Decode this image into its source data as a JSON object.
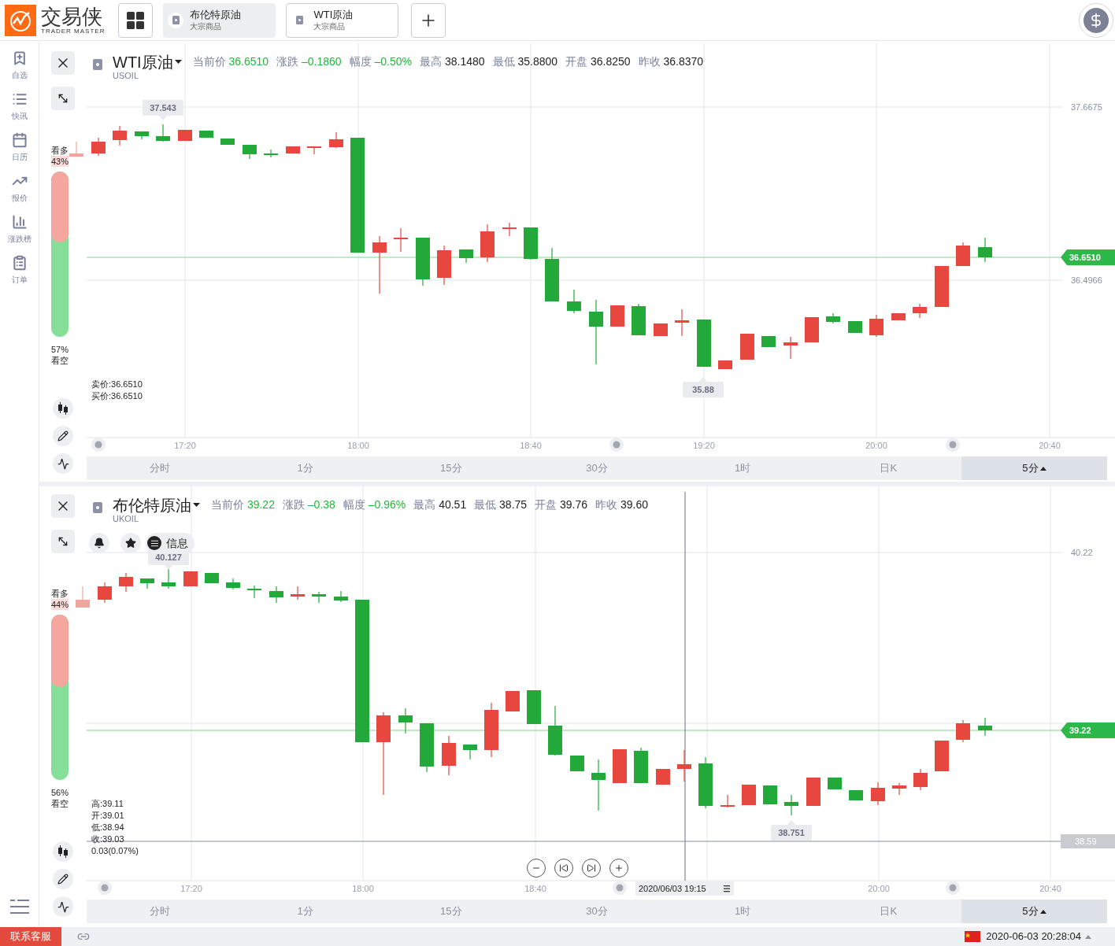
{
  "header": {
    "logo": {
      "name": "交易侠",
      "tagline": "TRADER MASTER"
    },
    "tabs": [
      {
        "title": "布伦特原油",
        "subtitle": "大宗商品",
        "selected": true
      },
      {
        "title": "WTI原油",
        "subtitle": "大宗商品",
        "selected": false
      }
    ]
  },
  "sidebar": {
    "items": [
      {
        "label": "自选"
      },
      {
        "label": "快讯"
      },
      {
        "label": "日历"
      },
      {
        "label": "报价"
      },
      {
        "label": "涨跌榜"
      },
      {
        "label": "订单"
      }
    ]
  },
  "panels": [
    {
      "symbol": "WTI原油",
      "code": "USOIL",
      "stats": [
        {
          "label": "当前价",
          "value": "36.6510",
          "color": "#22b83c"
        },
        {
          "label": "涨跌",
          "value": "–0.1860",
          "color": "#22b83c"
        },
        {
          "label": "幅度",
          "value": "–0.50%",
          "color": "#22b83c"
        },
        {
          "label": "最高",
          "value": "38.1480",
          "color": "#222222"
        },
        {
          "label": "最低",
          "value": "35.8800",
          "color": "#222222"
        },
        {
          "label": "开盘",
          "value": "36.8250",
          "color": "#222222"
        },
        {
          "label": "昨收",
          "value": "36.8370",
          "color": "#222222"
        }
      ],
      "sentiment": {
        "bull_label": "看多",
        "bull_pct": "43%",
        "level": 0.43,
        "bear_pct": "57%",
        "bear_label": "看空"
      },
      "info_lines": [
        "卖价:36.6510",
        "买价:36.6510"
      ],
      "y_ticks": [
        "37.6675",
        "36.4966"
      ],
      "price_tag": "36.6510",
      "markers": [
        "37.543",
        "35.88"
      ],
      "time_labels": [
        "17:20",
        "18:00",
        "18:40",
        "19:20",
        "20:00",
        "20:40"
      ],
      "timeframes": [
        {
          "label": "分时",
          "selected": false
        },
        {
          "label": "1分",
          "selected": false
        },
        {
          "label": "15分",
          "selected": false
        },
        {
          "label": "30分",
          "selected": false
        },
        {
          "label": "1时",
          "selected": false
        },
        {
          "label": "日K",
          "selected": false
        },
        {
          "label": "5分",
          "selected": true
        }
      ]
    },
    {
      "symbol": "布伦特原油",
      "code": "UKOIL",
      "stats": [
        {
          "label": "当前价",
          "value": "39.22",
          "color": "#22b83c"
        },
        {
          "label": "涨跌",
          "value": "–0.38",
          "color": "#22b83c"
        },
        {
          "label": "幅度",
          "value": "–0.96%",
          "color": "#22b83c"
        },
        {
          "label": "最高",
          "value": "40.51",
          "color": "#222222"
        },
        {
          "label": "最低",
          "value": "38.75",
          "color": "#222222"
        },
        {
          "label": "开盘",
          "value": "39.76",
          "color": "#222222"
        },
        {
          "label": "昨收",
          "value": "39.60",
          "color": "#222222"
        }
      ],
      "info_button": "信息",
      "sentiment": {
        "bull_label": "看多",
        "bull_pct": "44%",
        "level": 0.44,
        "bear_pct": "56%",
        "bear_label": "看空"
      },
      "info_lines": [
        "高:39.11",
        "开:39.01",
        "低:38.94",
        "收:39.03",
        "0.03(0.07%)"
      ],
      "y_ticks": [
        "40.22"
      ],
      "price_tag": "39.22",
      "guide_tag": "38.59",
      "markers": [
        "40.127",
        "38.751"
      ],
      "crosshair_label": "2020/06/03 19:15",
      "time_labels": [
        "17:20",
        "18:00",
        "18:40",
        "20:00",
        "20:40"
      ],
      "timeframes": [
        {
          "label": "分时",
          "selected": false
        },
        {
          "label": "1分",
          "selected": false
        },
        {
          "label": "15分",
          "selected": false
        },
        {
          "label": "30分",
          "selected": false
        },
        {
          "label": "1时",
          "selected": false
        },
        {
          "label": "日K",
          "selected": false
        },
        {
          "label": "5分",
          "selected": true
        }
      ]
    }
  ],
  "status_bar": {
    "support_button": "联系客服",
    "datetime": "2020-06-03 20:28:04"
  }
}
